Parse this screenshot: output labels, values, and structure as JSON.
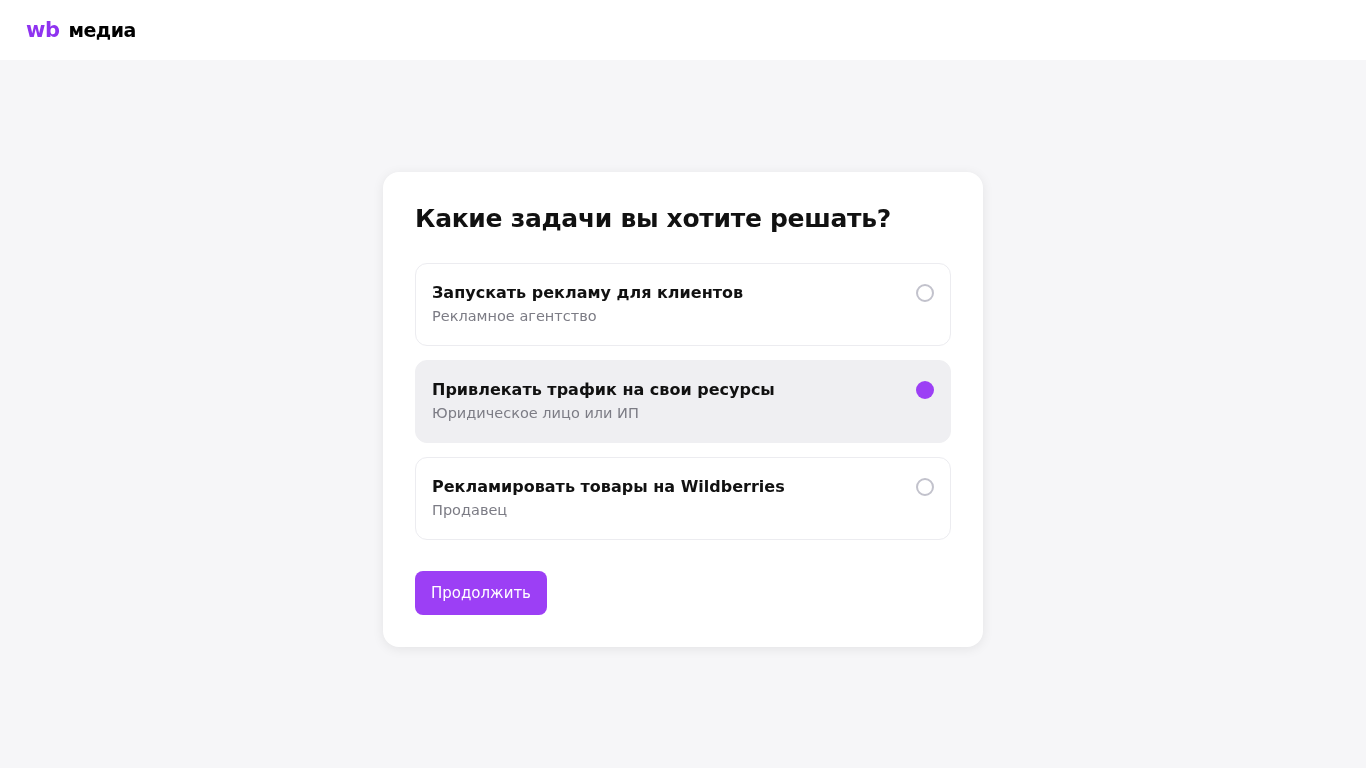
{
  "logo": {
    "mark": "wb",
    "name": "медиа"
  },
  "card": {
    "title": "Какие задачи вы хотите решать?",
    "options": [
      {
        "title": "Запускать рекламу для клиентов",
        "subtitle": "Рекламное агентство",
        "selected": false
      },
      {
        "title": "Привлекать трафик на свои ресурсы",
        "subtitle": "Юридическое лицо или ИП",
        "selected": true
      },
      {
        "title": "Рекламировать товары на Wildberries",
        "subtitle": "Продавец",
        "selected": false
      }
    ],
    "button": "Продолжить"
  }
}
